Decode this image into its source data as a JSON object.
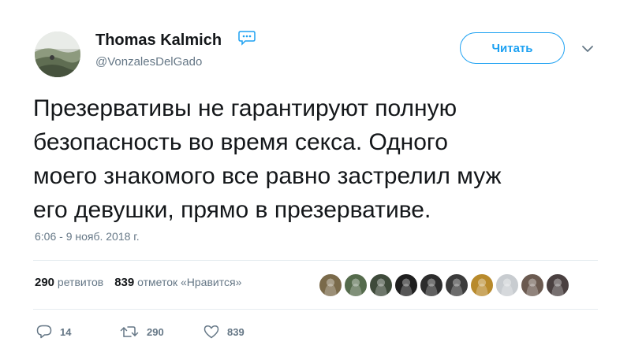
{
  "user": {
    "display_name": "Thomas Kalmich",
    "handle": "@VonzalesDelGado",
    "verified_icon": "speech-bubble-ellipsis-icon",
    "avatar_icon": "landscape-avatar"
  },
  "header": {
    "follow_label": "Читать",
    "menu_icon": "chevron-down-icon"
  },
  "tweet": {
    "text": "Презервативы не гарантируют полную\nбезопасность во время секса. Одного\nмоего знакомого все равно застрелил муж\nего девушки, прямо в презервативе.",
    "timestamp": "6:06 - 9 нояб. 2018 г."
  },
  "stats": {
    "retweets_count": "290",
    "retweets_label": "ретвитов",
    "likes_count": "839",
    "likes_label": "отметок «Нравится»"
  },
  "likers": [
    {
      "color": "#7a6a4a"
    },
    {
      "color": "#556b4c"
    },
    {
      "color": "#3e4a3a"
    },
    {
      "color": "#1f1f1f"
    },
    {
      "color": "#2c2c2c"
    },
    {
      "color": "#3b3b3b"
    },
    {
      "color": "#b88a2c"
    },
    {
      "color": "#c8ccd0"
    },
    {
      "color": "#6b5a50"
    },
    {
      "color": "#4a4040"
    }
  ],
  "actions": {
    "reply_count": "14",
    "retweet_count": "290",
    "like_count": "839"
  },
  "colors": {
    "accent": "#1da1f2",
    "secondary_text": "#657786",
    "primary_text": "#14171a",
    "divider": "#e6ecf0"
  }
}
